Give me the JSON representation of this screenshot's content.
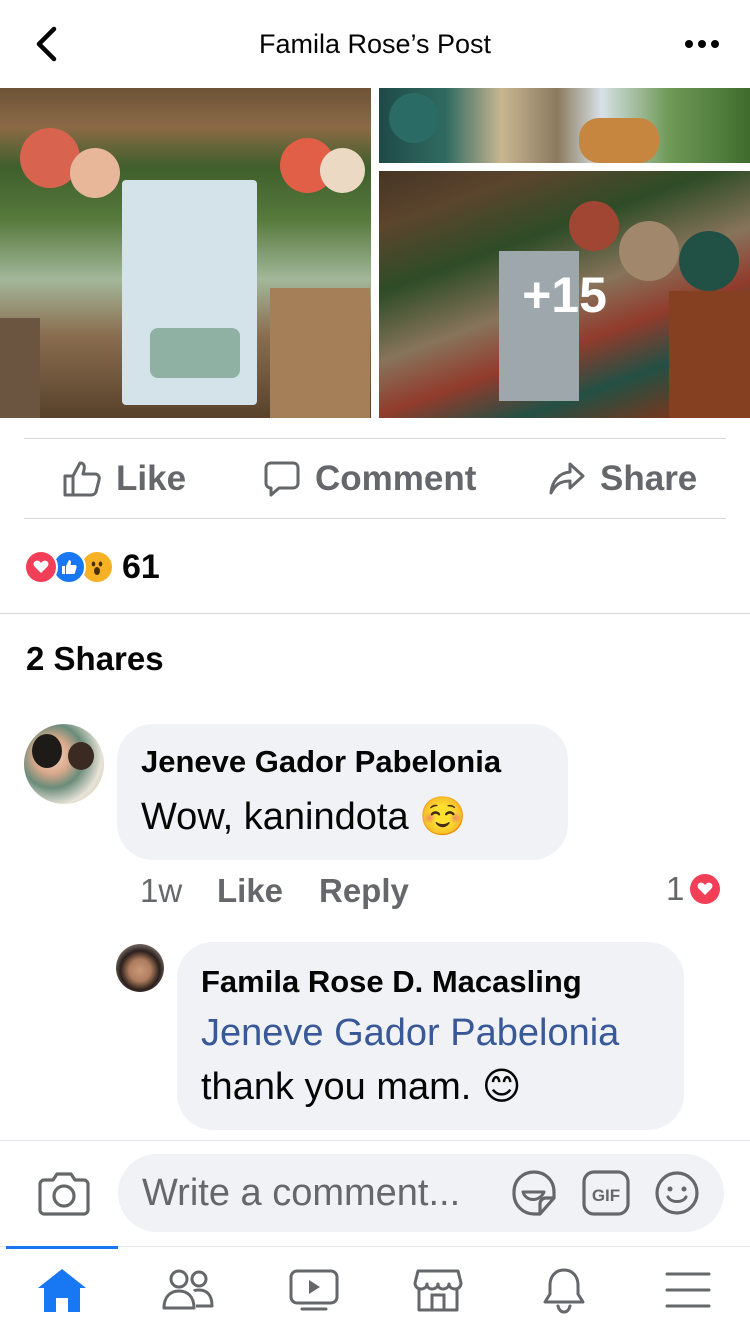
{
  "header": {
    "title": "Famila Rose’s Post",
    "back_icon": "chevron-left-icon",
    "more_icon": "more-dots-icon"
  },
  "photos": {
    "more_count_label": "+15"
  },
  "actions": {
    "like": "Like",
    "comment": "Comment",
    "share": "Share"
  },
  "reactions": {
    "types": [
      "love",
      "like",
      "wow"
    ],
    "count": "61"
  },
  "shares": {
    "label": "2 Shares"
  },
  "comments": [
    {
      "author": "Jeneve Gador Pabelonia",
      "text": "Wow, kanindota ☺️",
      "time": "1w",
      "like_label": "Like",
      "reply_label": "Reply",
      "reaction_count": "1",
      "reaction_type": "love"
    }
  ],
  "reply": {
    "author": "Famila Rose D. Macasling",
    "mention": "Jeneve Gador Pabelonia",
    "text": "thank you mam. 😊"
  },
  "composer": {
    "placeholder": "Write a comment...",
    "icons": [
      "camera-icon",
      "sticker-icon",
      "gif-icon",
      "emoji-icon"
    ]
  },
  "tabbar": {
    "items": [
      "home-icon",
      "friends-icon",
      "watch-icon",
      "marketplace-icon",
      "notifications-icon",
      "menu-icon"
    ],
    "active": "home-icon"
  },
  "colors": {
    "accent": "#1877f2",
    "love": "#f33e58",
    "like": "#1877f2",
    "wow": "#f7b125",
    "mention": "#385898",
    "secondary_text": "#65676b"
  }
}
